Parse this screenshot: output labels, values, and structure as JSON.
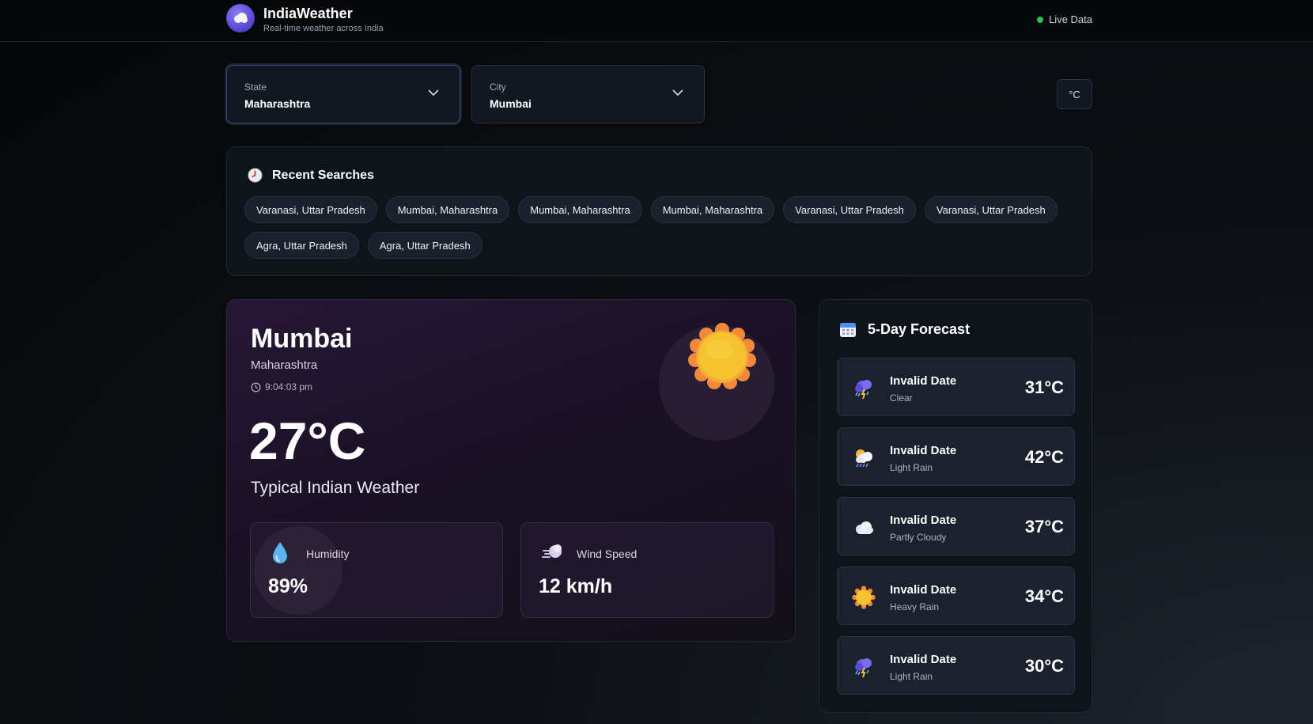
{
  "header": {
    "brand_title": "IndiaWeather",
    "brand_subtitle": "Real-time weather across India",
    "live_label": "Live Data"
  },
  "selectors": {
    "state": {
      "label": "State",
      "value": "Maharashtra"
    },
    "city": {
      "label": "City",
      "value": "Mumbai"
    },
    "unit_label": "°C"
  },
  "recent": {
    "title": "Recent Searches",
    "items": [
      "Varanasi, Uttar Pradesh",
      "Mumbai, Maharashtra",
      "Mumbai, Maharashtra",
      "Mumbai, Maharashtra",
      "Varanasi, Uttar Pradesh",
      "Varanasi, Uttar Pradesh",
      "Agra, Uttar Pradesh",
      "Agra, Uttar Pradesh"
    ]
  },
  "current": {
    "city": "Mumbai",
    "state": "Maharashtra",
    "time": "9:04:03 pm",
    "temperature": "27°C",
    "description": "Typical Indian Weather",
    "humidity": {
      "label": "Humidity",
      "value": "89%"
    },
    "wind": {
      "label": "Wind Speed",
      "value": "12 km/h"
    }
  },
  "forecast": {
    "title": "5-Day Forecast",
    "days": [
      {
        "date": "Invalid Date",
        "condition": "Clear",
        "temp": "31°C",
        "icon": "thunderstorm-icon"
      },
      {
        "date": "Invalid Date",
        "condition": "Light Rain",
        "temp": "42°C",
        "icon": "sun-rain-cloud-icon"
      },
      {
        "date": "Invalid Date",
        "condition": "Partly Cloudy",
        "temp": "37°C",
        "icon": "cloud-icon"
      },
      {
        "date": "Invalid Date",
        "condition": "Heavy Rain",
        "temp": "34°C",
        "icon": "sun-icon"
      },
      {
        "date": "Invalid Date",
        "condition": "Light Rain",
        "temp": "30°C",
        "icon": "thunderstorm-icon"
      }
    ]
  },
  "colors": {
    "live_dot": "#22c55e",
    "sun": "#f6c330",
    "sun_rays": "#f2883a"
  }
}
